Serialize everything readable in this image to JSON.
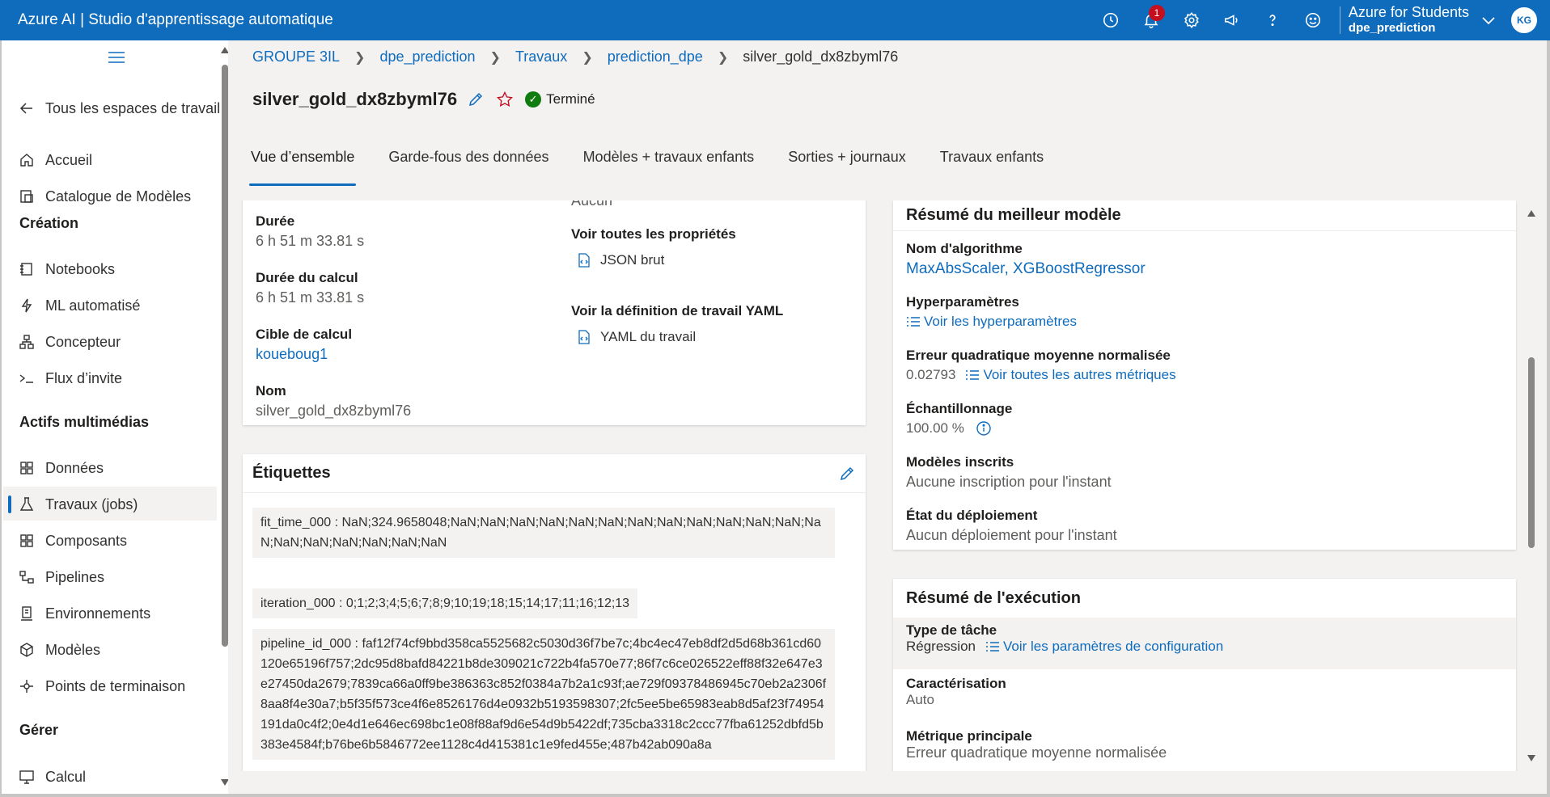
{
  "app": {
    "title": "Azure AI | Studio d'apprentissage automatique",
    "notifications_count": "1",
    "account_name": "Azure for Students",
    "workspace": "dpe_prediction",
    "avatar_initials": "KG",
    "accent": "#0f6cbd"
  },
  "sidebar": {
    "back_label": "Tous les espaces de travail",
    "home": "Accueil",
    "catalog": "Catalogue de Modèles",
    "section_create": "Création",
    "notebooks": "Notebooks",
    "automl": "ML automatisé",
    "designer": "Concepteur",
    "promptflow": "Flux d’invite",
    "section_assets": "Actifs multimédias",
    "data": "Données",
    "jobs": "Travaux (jobs)",
    "components": "Composants",
    "pipelines": "Pipelines",
    "environments": "Environnements",
    "models": "Modèles",
    "endpoints": "Points de terminaison",
    "section_manage": "Gérer",
    "compute": "Calcul"
  },
  "breadcrumb": [
    "GROUPE 3IL",
    "dpe_prediction",
    "Travaux",
    "prediction_dpe",
    "silver_gold_dx8zbyml76"
  ],
  "job": {
    "name": "silver_gold_dx8zbyml76",
    "status": "Terminé"
  },
  "tabs": [
    "Vue d’ensemble",
    "Garde-fous des données",
    "Modèles + travaux enfants",
    "Sorties + journaux",
    "Travaux enfants"
  ],
  "properties": {
    "clipped_value": "Aucun",
    "duration_label": "Durée",
    "duration_value": "6 h 51 m 33.81 s",
    "compute_duration_label": "Durée du calcul",
    "compute_duration_value": "6 h 51 m 33.81 s",
    "compute_target_label": "Cible de calcul",
    "compute_target_value": "koueboug1",
    "name_label": "Nom",
    "name_value": "silver_gold_dx8zbyml76",
    "all_props_label": "Voir toutes les propriétés",
    "raw_json": "JSON brut",
    "yaml_label": "Voir la définition de travail YAML",
    "yaml_link": "YAML du travail"
  },
  "tags": {
    "title": "Étiquettes",
    "items": [
      "fit_time_000 : NaN;324.9658048;NaN;NaN;NaN;NaN;NaN;NaN;NaN;NaN;NaN;NaN;NaN;NaN;NaN;NaN;NaN;NaN;NaN;NaN;NaN",
      "iteration_000 : 0;1;2;3;4;5;6;7;8;9;10;19;18;15;14;17;11;16;12;13",
      "pipeline_id_000 : faf12f74cf9bbd358ca5525682c5030d36f7be7c;4bc4ec47eb8df2d5d68b361cd60120e65196f757;2dc95d8bafd84221b8de309021c722b4fa570e77;86f7c6ce026522eff88f32e647e3e27450da2679;7839ca66a0ff9be386363c852f0384a7b2a1c93f;ae729f09378486945c70eb2a2306f8aa8f4e30a7;b5f35f573ce4f6e8526176d4e0932b5193598307;2fc5ee5be65983eab8d5af23f74954191da0c4f2;0e4d1e646ec698bc1e08f88af9d6e54d9b5422df;735cba3318c2ccc77fba61252dbfd5b383e4584f;b76be6b5846772ee1128c4d415381c1e9fed455e;487b42ab090a8a"
    ]
  },
  "best_model": {
    "title": "Résumé du meilleur modèle",
    "algo_label": "Nom d'algorithme",
    "algo_value": "MaxAbsScaler, XGBoostRegressor",
    "hyper_label": "Hyperparamètres",
    "hyper_link": "Voir les hyperparamètres",
    "metric_label": "Erreur quadratique moyenne normalisée",
    "metric_value": "0.02793",
    "metric_link": "Voir toutes les autres métriques",
    "sampling_label": "Échantillonnage",
    "sampling_value": "100.00 %",
    "registered_label": "Modèles inscrits",
    "registered_value": "Aucune inscription pour l'instant",
    "deploy_label": "État du déploiement",
    "deploy_value": "Aucun déploiement pour l'instant"
  },
  "run_summary": {
    "title": "Résumé de l'exécution",
    "task_label": "Type de tâche",
    "task_value": "Régression",
    "config_link": "Voir les paramètres de configuration",
    "featurization_label": "Caractérisation",
    "featurization_value": "Auto",
    "primary_metric_label": "Métrique principale",
    "primary_metric_value": "Erreur quadratique moyenne normalisée"
  }
}
